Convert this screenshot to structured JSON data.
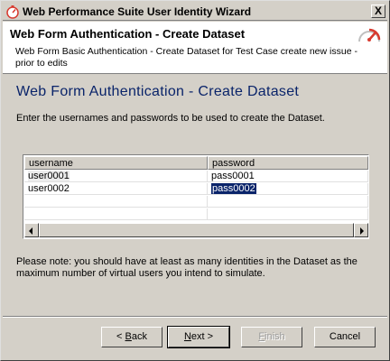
{
  "window": {
    "title": "Web Performance Suite User Identity Wizard",
    "close_label": "X"
  },
  "header": {
    "title": "Web Form Authentication - Create Dataset",
    "description": "Web Form Basic Authentication - Create Dataset for Test Case create new issue - prior to edits"
  },
  "content": {
    "title": "Web Form Authentication - Create Dataset",
    "instruction": "Enter the usernames and passwords to be used to create the Dataset."
  },
  "table": {
    "columns": [
      "username",
      "password"
    ],
    "rows": [
      {
        "username": "user0001",
        "password": "pass0001"
      },
      {
        "username": "user0002",
        "password": "pass0002"
      }
    ]
  },
  "note": "Please note: you should have at least as many identities in the Dataset as the maximum number of virtual users you intend to simulate.",
  "buttons": {
    "back_mnemonic": "B",
    "back_rest": "ack",
    "back_prefix": "< ",
    "next_mnemonic": "N",
    "next_rest": "ext >",
    "finish_mnemonic": "F",
    "finish_rest": "inish",
    "cancel": "Cancel"
  },
  "colors": {
    "accent": "#0a246a",
    "face": "#d4d0c8",
    "logo_red": "#d83a2f"
  }
}
